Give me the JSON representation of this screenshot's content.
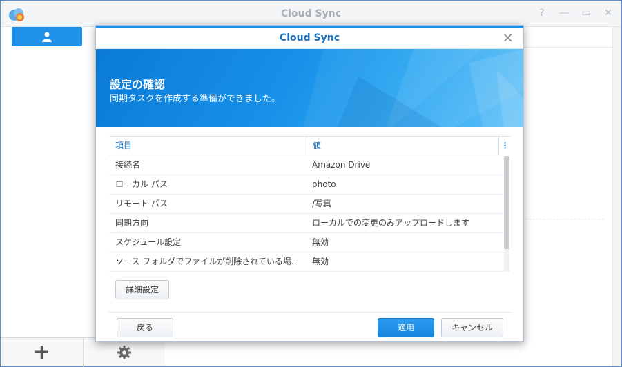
{
  "app": {
    "title": "Cloud Sync",
    "window_controls": [
      "help-icon",
      "minimize-icon",
      "maximize-icon",
      "close-icon"
    ]
  },
  "sidebar": {
    "user_button_icon": "user-icon",
    "bottom_buttons": [
      "plus-icon",
      "gear-icon"
    ]
  },
  "dialog": {
    "title": "Cloud Sync",
    "banner_heading": "設定の確認",
    "banner_subtitle": "同期タスクを作成する準備ができました。",
    "table": {
      "columns": [
        "項目",
        "値"
      ],
      "rows": [
        {
          "item": "接続名",
          "value": "Amazon Drive"
        },
        {
          "item": "ローカル パス",
          "value": "photo"
        },
        {
          "item": "リモート パス",
          "value": "/写真"
        },
        {
          "item": "同期方向",
          "value": "ローカルでの変更のみアップロードします"
        },
        {
          "item": "スケジュール設定",
          "value": "無効"
        },
        {
          "item": "ソース フォルダでファイルが削除されている場...",
          "value": "無効"
        }
      ]
    },
    "advanced_button": "詳細設定",
    "back_button": "戻る",
    "apply_button": "適用",
    "cancel_button": "キャンセル"
  },
  "colors": {
    "accent": "#1f8fe5",
    "title_blue": "#1a72c2"
  }
}
